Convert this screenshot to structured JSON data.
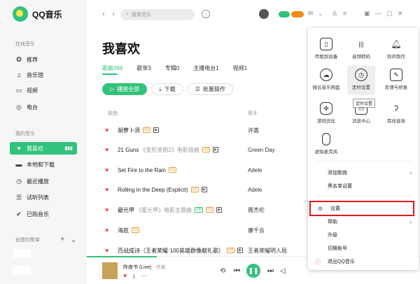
{
  "app": {
    "name": "QQ音乐"
  },
  "sidebar": {
    "section_online": "在线音乐",
    "online_items": [
      {
        "label": "推荐",
        "icon": "compass-icon"
      },
      {
        "label": "音乐馆",
        "icon": "music-note-icon"
      },
      {
        "label": "视频",
        "icon": "video-icon"
      },
      {
        "label": "电台",
        "icon": "radio-icon"
      }
    ],
    "section_mine": "我的音乐",
    "mine_items": [
      {
        "label": "我喜欢",
        "icon": "heart-icon",
        "active": true
      },
      {
        "label": "本地和下载",
        "icon": "download-icon"
      },
      {
        "label": "最近播放",
        "icon": "clock-icon"
      },
      {
        "label": "试听列表",
        "icon": "list-icon"
      },
      {
        "label": "已购音乐",
        "icon": "purchased-icon"
      }
    ],
    "section_created": "创建的歌单"
  },
  "topbar": {
    "search_placeholder": "搜索音乐"
  },
  "main": {
    "title": "我喜欢",
    "tabs": [
      {
        "label": "歌曲394",
        "active": true
      },
      {
        "label": "歌单3"
      },
      {
        "label": "专辑0"
      },
      {
        "label": "主播电台1"
      },
      {
        "label": "视频1"
      }
    ],
    "buttons": {
      "play_all": "播放全部",
      "download": "下载",
      "batch": "批量操作"
    },
    "columns": {
      "song": "歌曲",
      "artist": "歌手"
    },
    "songs": [
      {
        "title": "胡萝卜须",
        "sub": "",
        "artist": "许嵩"
      },
      {
        "title": "21 Guns",
        "sub": "《变形金刚2》电影插曲",
        "artist": "Green Day"
      },
      {
        "title": "Set Fire to the Rain",
        "sub": "",
        "artist": "Adele"
      },
      {
        "title": "Rolling in the Deep (Explicit)",
        "sub": "",
        "artist": "Adele"
      },
      {
        "title": "最元甲",
        "sub": "《霍元甲》电影主题曲",
        "artist": "周杰伦"
      },
      {
        "title": "海底",
        "sub": "",
        "artist": "康千云"
      },
      {
        "title": "百战成诗（王者荣耀·100英雄群像献礼歌）",
        "sub": "",
        "artist": "王者荣耀明人局"
      }
    ]
  },
  "player": {
    "title": "昨夜书 (Live)",
    "artist": "许嵩"
  },
  "menu": {
    "grid": [
      {
        "label": "传歌到设备",
        "icon": "phone-icon"
      },
      {
        "label": "音频转码",
        "icon": "waveform-icon"
      },
      {
        "label": "铃声制作",
        "icon": "bell-icon"
      },
      {
        "label": "微云音乐网盘",
        "icon": "cloud-icon"
      },
      {
        "label": "定时设置",
        "icon": "timer-icon"
      },
      {
        "label": "反馈与修复",
        "icon": "feedback-icon"
      },
      {
        "label": "游戏优化",
        "icon": "gamepad-icon"
      },
      {
        "label": "消息中心",
        "icon": "message-icon"
      },
      {
        "label": "耳纹音效",
        "icon": "ear-icon"
      },
      {
        "label": "虚拟麦克风",
        "icon": "microphone-icon"
      }
    ],
    "tooltip": "定时设置",
    "rows": [
      {
        "label": "添加歌曲",
        "arrow": true
      },
      {
        "label": "黑名单设置",
        "arrow": false
      },
      {
        "label": "设置",
        "arrow": false,
        "highlight": true,
        "icon": "gear-icon"
      },
      {
        "label": "帮助",
        "arrow": true
      },
      {
        "label": "升级",
        "arrow": false
      },
      {
        "label": "切换帐号",
        "arrow": false
      },
      {
        "label": "退出QQ音乐",
        "arrow": false,
        "icon": "exit-icon"
      }
    ]
  },
  "colors": {
    "accent": "#31c27c",
    "heart": "#ee4d4d",
    "highlight": "#e0191d"
  }
}
